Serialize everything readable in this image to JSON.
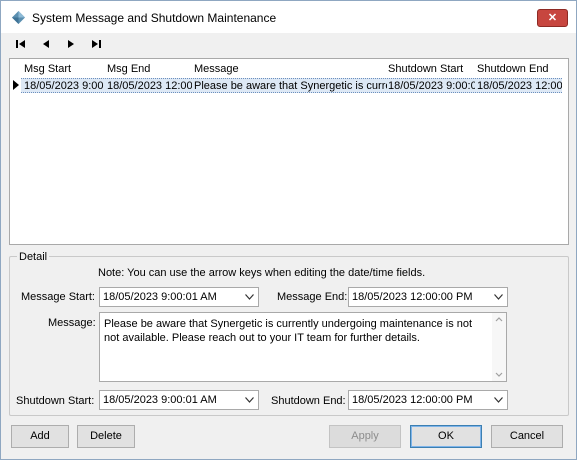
{
  "window": {
    "title": "System Message and Shutdown Maintenance",
    "close_label": "✕"
  },
  "navigator": {
    "icons": [
      "first-record-icon",
      "prior-record-icon",
      "next-record-icon",
      "last-record-icon"
    ]
  },
  "grid": {
    "columns": [
      "Msg Start",
      "Msg End",
      "Message",
      "Shutdown Start",
      "Shutdown End"
    ],
    "rows": [
      [
        "18/05/2023 9:00:",
        "18/05/2023 12:00",
        "Please be aware that Synergetic is curre",
        "18/05/2023 9:00:0",
        "18/05/2023 12:00"
      ]
    ]
  },
  "detail": {
    "legend": "Detail",
    "note": "Note:  You can use the arrow keys when editing the date/time fields.",
    "message_start_label": "Message Start:",
    "message_start_value": "18/05/2023 9:00:01 AM",
    "message_end_label": "Message End:",
    "message_end_value": "18/05/2023 12:00:00 PM",
    "message_label": "Message:",
    "message_text": "Please be aware that Synergetic is currently undergoing maintenance is not not available. Please reach out to your IT team for further details.",
    "shutdown_start_label": "Shutdown Start:",
    "shutdown_start_value": "18/05/2023 9:00:01 AM",
    "shutdown_end_label": "Shutdown End:",
    "shutdown_end_value": "18/05/2023 12:00:00 PM"
  },
  "buttons": {
    "add": "Add",
    "delete": "Delete",
    "apply": "Apply",
    "ok": "OK",
    "cancel": "Cancel"
  },
  "colors": {
    "close_button": "#c7463f",
    "selected_row": "#dde8f5",
    "default_button_border": "#3c7fb1"
  }
}
